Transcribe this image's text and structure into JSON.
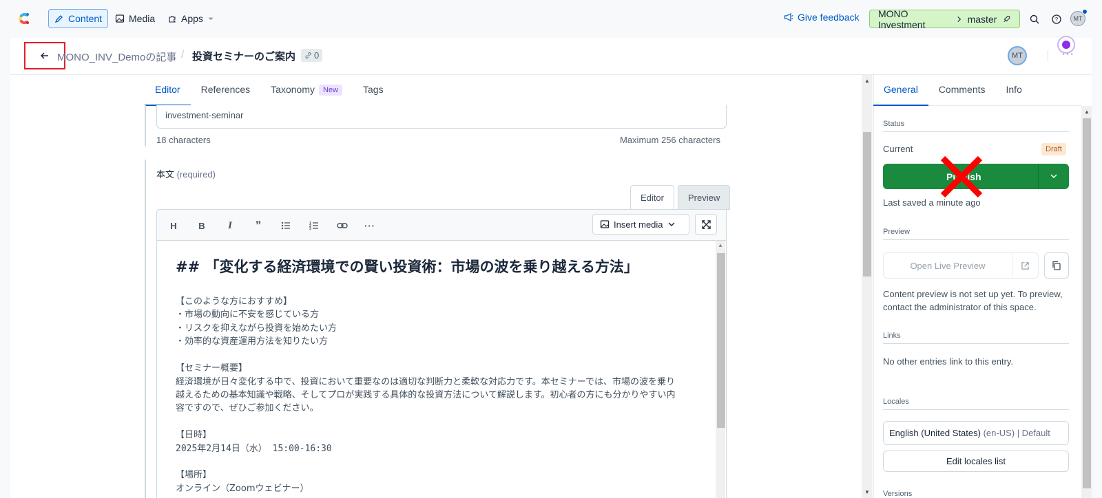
{
  "topnav": {
    "content_label": "Content",
    "media_label": "Media",
    "apps_label": "Apps",
    "feedback_label": "Give feedback",
    "env_space": "MONO Investment",
    "env_branch": "master",
    "user_initials": "MT"
  },
  "entry": {
    "breadcrumb": "MONO_INV_Demoの記事",
    "title": "投資セミナーのご案内",
    "link_count": "0",
    "avatar_initials": "MT"
  },
  "editor_tabs": {
    "editor": "Editor",
    "references": "References",
    "taxonomy": "Taxonomy",
    "taxonomy_badge": "New",
    "tags": "Tags"
  },
  "slug_field": {
    "value": "investment-seminar",
    "char_count": "18 characters",
    "max": "Maximum 256 characters"
  },
  "body_field": {
    "label": "本文",
    "required": "(required)",
    "mode_editor": "Editor",
    "mode_preview": "Preview",
    "insert_media": "Insert media",
    "heading": "## 「変化する経済環境での賢い投資術：市場の波を乗り越える方法」",
    "lines": [
      "【このような方におすすめ】",
      "・市場の動向に不安を感じている方",
      "・リスクを抑えながら投資を始めたい方",
      "・効率的な資産運用方法を知りたい方",
      "【セミナー概要】",
      "経済環境が日々変化する中で、投資において重要なのは適切な判断力と柔軟な対応力です。本セミナーでは、市場の波を乗り",
      "越えるための基本知識や戦略、そしてプロが実践する具体的な投資方法について解説します。初心者の方にも分かりやすい内",
      "容ですので、ぜひご参加ください。",
      "【日時】",
      "2025年2月14日（水） 15:00-16:30",
      "【場所】",
      "オンライン（Zoomウェビナー）"
    ]
  },
  "sidebar": {
    "tabs": [
      "General",
      "Comments",
      "Info"
    ],
    "status_title": "Status",
    "current_label": "Current",
    "draft_badge": "Draft",
    "publish_label": "Publish",
    "last_saved": "Last saved a minute ago",
    "preview_title": "Preview",
    "open_live_preview": "Open Live Preview",
    "preview_note_1": "Content preview is not set up yet. To preview,",
    "preview_note_2": "contact the administrator of this space.",
    "links_title": "Links",
    "links_text": "No other entries link to this entry.",
    "locales_title": "Locales",
    "locale_name": "English (United States)",
    "locale_code": "(en-US) | Default",
    "edit_locales": "Edit locales list",
    "versions_title": "Versions"
  },
  "colors": {
    "accent": "#0059c8",
    "publish_green": "#1a8b3e",
    "env_green": "#d5f5c8",
    "draft_bg": "#fce8d5",
    "highlight_red": "#e0202b"
  }
}
